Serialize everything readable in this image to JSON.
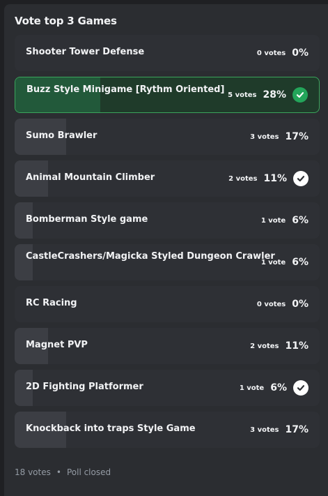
{
  "poll": {
    "title": "Vote top 3 Games",
    "answers": [
      {
        "label": "Shooter Tower Defense",
        "votes": "0 votes",
        "percent": "0%",
        "fraction": 0.0,
        "voted": false,
        "selected": false
      },
      {
        "label": "Buzz Style Minigame [Rythm Oriented]",
        "votes": "5 votes",
        "percent": "28%",
        "fraction": 0.28,
        "voted": true,
        "selected": true
      },
      {
        "label": "Sumo Brawler",
        "votes": "3 votes",
        "percent": "17%",
        "fraction": 0.17,
        "voted": false,
        "selected": false
      },
      {
        "label": "Animal Mountain Climber",
        "votes": "2 votes",
        "percent": "11%",
        "fraction": 0.11,
        "voted": false,
        "selected": true
      },
      {
        "label": "Bomberman Style game",
        "votes": "1 vote",
        "percent": "6%",
        "fraction": 0.06,
        "voted": false,
        "selected": false
      },
      {
        "label": "CastleCrashers/Magicka Styled Dungeon Crawler",
        "votes": "1 vote",
        "percent": "6%",
        "fraction": 0.06,
        "voted": false,
        "selected": false
      },
      {
        "label": "RC Racing",
        "votes": "0 votes",
        "percent": "0%",
        "fraction": 0.0,
        "voted": false,
        "selected": false
      },
      {
        "label": "Magnet PVP",
        "votes": "2 votes",
        "percent": "11%",
        "fraction": 0.11,
        "voted": false,
        "selected": false
      },
      {
        "label": "2D Fighting Platformer",
        "votes": "1 vote",
        "percent": "6%",
        "fraction": 0.06,
        "voted": false,
        "selected": true
      },
      {
        "label": "Knockback into traps Style Game",
        "votes": "3 votes",
        "percent": "17%",
        "fraction": 0.17,
        "voted": false,
        "selected": false
      }
    ],
    "footer": {
      "total_votes": "18 votes",
      "separator": "•",
      "status": "Poll closed"
    }
  },
  "colors": {
    "page_bg": "#1f2023",
    "card_bg": "#2b2d31",
    "answer_bg": "#2e3035",
    "answer_fill": "#3c3e44",
    "voted_bg": "#1f3b2a",
    "voted_fill": "#22593a",
    "voted_border": "#3ba55c",
    "check_green": "#23a55a",
    "check_white": "#ffffff"
  },
  "icons": {
    "check": "check-circle-icon"
  }
}
